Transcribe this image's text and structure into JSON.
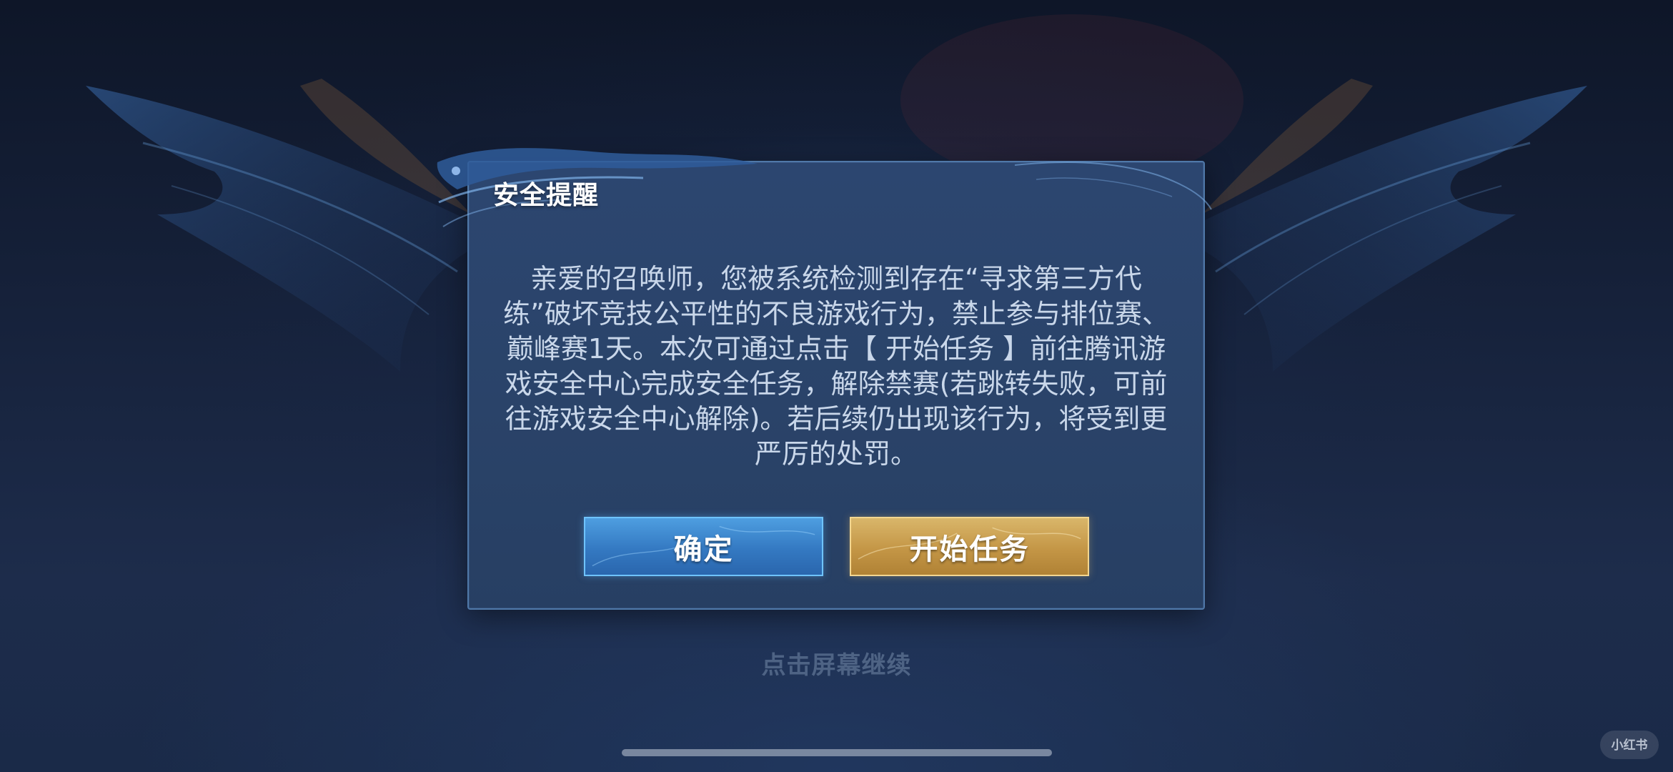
{
  "dialog": {
    "title": "安全提醒",
    "message": "亲爱的召唤师，您被系统检测到存在“寻求第三方代练”破坏竞技公平性的不良游戏行为，禁止参与排位赛、巅峰赛1天。本次可通过点击【 开始任务 】前往腾讯游戏安全中心完成安全任务，解除禁赛(若跳转失败，可前往游戏安全中心解除)。若后续仍出现该行为，将受到更严厉的处罚。",
    "confirm_label": "确定",
    "task_label": "开始任务"
  },
  "tap_hint": "点击屏幕继续",
  "watermark": "小红书",
  "colors": {
    "confirm_button": "#3a84cc",
    "task_button": "#c99d4e",
    "panel": "#2b4570"
  }
}
